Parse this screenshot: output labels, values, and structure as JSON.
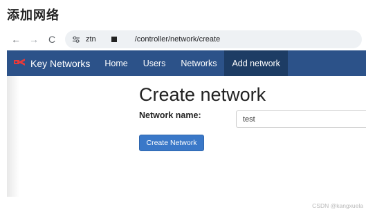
{
  "doc_heading": "添加网络",
  "browser": {
    "back_label": "←",
    "forward_label": "→",
    "reload_label": "C",
    "host": "ztn",
    "path": "/controller/network/create"
  },
  "navbar": {
    "brand": "Key Networks",
    "links": [
      {
        "label": "Home"
      },
      {
        "label": "Users"
      },
      {
        "label": "Networks"
      },
      {
        "label": "Add network",
        "active": true
      }
    ]
  },
  "form": {
    "title": "Create network",
    "name_label": "Network name:",
    "name_value": "test",
    "submit_label": "Create Network"
  },
  "watermark": "CSDN @kangxuela",
  "colors": {
    "navbar_bg": "#2c5289",
    "navbar_active_bg": "#1d3c64",
    "button_bg": "#3a78c8",
    "logo_red": "#e83a3a"
  }
}
